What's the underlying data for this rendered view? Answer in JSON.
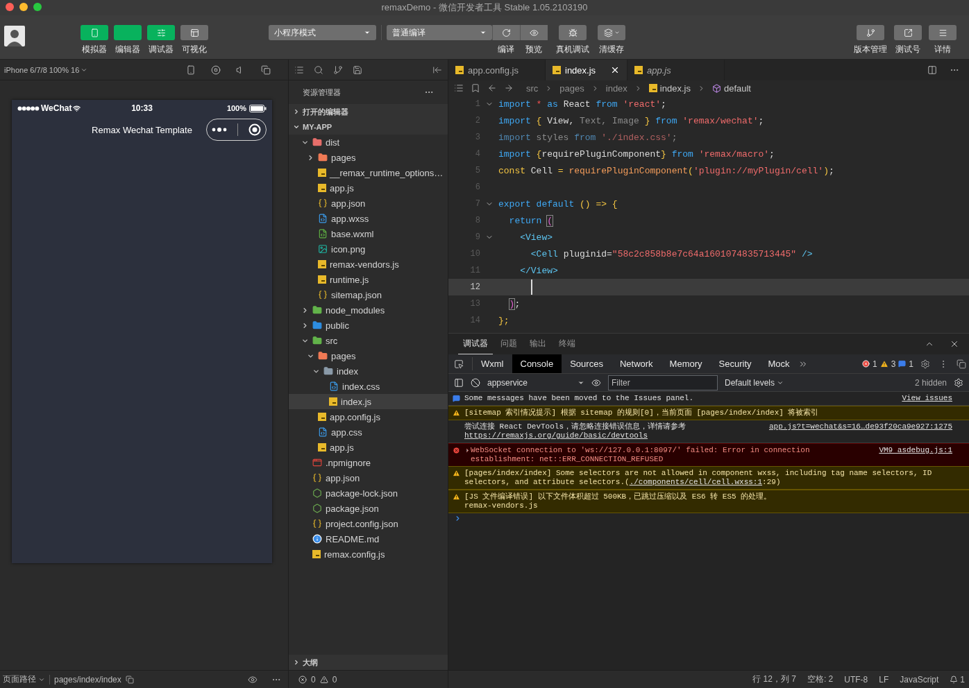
{
  "window": {
    "title": "remaxDemo - 微信开发者工具 Stable 1.05.2103190"
  },
  "toolbar": {
    "views": [
      {
        "label": "模拟器",
        "on": true
      },
      {
        "label": "编辑器",
        "on": true
      },
      {
        "label": "调试器",
        "on": true
      },
      {
        "label": "可视化",
        "on": false
      }
    ],
    "mode_select": "小程序模式",
    "compile_select": "普通编译",
    "actions": [
      {
        "label": "编译"
      },
      {
        "label": "预览"
      }
    ],
    "tools": [
      {
        "label": "真机调试",
        "dropdown": false
      },
      {
        "label": "清缓存",
        "dropdown": true
      }
    ],
    "right": [
      {
        "label": "版本管理"
      },
      {
        "label": "测试号"
      },
      {
        "label": "详情"
      }
    ]
  },
  "simulator": {
    "device": "iPhone 6/7/8 100% 16",
    "carrier": "WeChat",
    "time": "10:33",
    "battery": "100%",
    "page_title": "Remax Wechat Template"
  },
  "explorer": {
    "title": "资源管理器",
    "sections": [
      {
        "label": "打开的编辑器",
        "expanded": false
      },
      {
        "label": "MY-APP",
        "expanded": true
      }
    ],
    "tree": [
      {
        "name": "dist",
        "kind": "folder-red",
        "expanded": true,
        "selected": false,
        "children": [
          {
            "name": "pages",
            "kind": "folder-orange",
            "expanded": false,
            "selected": false
          },
          {
            "name": "__remax_runtime_options…",
            "kind": "js",
            "selected": false
          },
          {
            "name": "app.js",
            "kind": "js",
            "selected": false
          },
          {
            "name": "app.json",
            "kind": "json",
            "selected": false
          },
          {
            "name": "app.wxss",
            "kind": "css",
            "selected": false
          },
          {
            "name": "base.wxml",
            "kind": "wxml",
            "selected": false
          },
          {
            "name": "icon.png",
            "kind": "image",
            "selected": false
          },
          {
            "name": "remax-vendors.js",
            "kind": "js",
            "selected": false
          },
          {
            "name": "runtime.js",
            "kind": "js",
            "selected": false
          },
          {
            "name": "sitemap.json",
            "kind": "json",
            "selected": false
          }
        ]
      },
      {
        "name": "node_modules",
        "kind": "folder-green",
        "expanded": false,
        "selected": false
      },
      {
        "name": "public",
        "kind": "folder-blue",
        "expanded": false,
        "selected": false
      },
      {
        "name": "src",
        "kind": "folder-green",
        "expanded": true,
        "selected": false,
        "children": [
          {
            "name": "pages",
            "kind": "folder-orange",
            "expanded": true,
            "selected": false,
            "children": [
              {
                "name": "index",
                "kind": "folder-grey",
                "expanded": true,
                "selected": false,
                "children": [
                  {
                    "name": "index.css",
                    "kind": "css",
                    "selected": false
                  },
                  {
                    "name": "index.js",
                    "kind": "js",
                    "selected": true
                  }
                ]
              }
            ]
          },
          {
            "name": "app.config.js",
            "kind": "js",
            "selected": false
          },
          {
            "name": "app.css",
            "kind": "css",
            "selected": false
          },
          {
            "name": "app.js",
            "kind": "js",
            "selected": false
          }
        ]
      },
      {
        "name": ".npmignore",
        "kind": "ignore",
        "selected": false
      },
      {
        "name": "app.json",
        "kind": "json",
        "selected": false
      },
      {
        "name": "package-lock.json",
        "kind": "node",
        "selected": false
      },
      {
        "name": "package.json",
        "kind": "node",
        "selected": false
      },
      {
        "name": "project.config.json",
        "kind": "json",
        "selected": false
      },
      {
        "name": "README.md",
        "kind": "info",
        "selected": false
      },
      {
        "name": "remax.config.js",
        "kind": "js",
        "selected": false
      }
    ],
    "outline": {
      "label": "大纲",
      "expanded": false
    }
  },
  "editor": {
    "tabs": [
      {
        "name": "app.config.js",
        "selected": false,
        "preview": false
      },
      {
        "name": "index.js",
        "selected": true,
        "preview": false
      },
      {
        "name": "app.js",
        "selected": false,
        "preview": true
      }
    ],
    "breadcrumb": [
      {
        "label": "src",
        "kind": "folder"
      },
      {
        "label": "pages",
        "kind": "folder"
      },
      {
        "label": "index",
        "kind": "folder"
      },
      {
        "label": "index.js",
        "kind": "file"
      },
      {
        "label": "default",
        "kind": "symbol"
      }
    ],
    "lines": [
      {
        "number": "1",
        "fold": true,
        "current": false,
        "tokens": [
          {
            "text": "import ",
            "kind": "kw"
          },
          {
            "text": "* ",
            "kind": "op"
          },
          {
            "text": "as ",
            "kind": "kw"
          },
          {
            "text": "React ",
            "kind": "id"
          },
          {
            "text": "from ",
            "kind": "kw"
          },
          {
            "text": "'react'",
            "kind": "str"
          },
          {
            "text": ";",
            "kind": "id"
          }
        ]
      },
      {
        "number": "2",
        "fold": false,
        "current": false,
        "tokens": [
          {
            "text": "import ",
            "kind": "kw"
          },
          {
            "text": "{ ",
            "kind": "decl"
          },
          {
            "text": "View, ",
            "kind": "id"
          },
          {
            "text": "Text, Image ",
            "kind": "dim"
          },
          {
            "text": "} ",
            "kind": "decl"
          },
          {
            "text": "from ",
            "kind": "kw"
          },
          {
            "text": "'remax/wechat'",
            "kind": "str"
          },
          {
            "text": ";",
            "kind": "id"
          }
        ]
      },
      {
        "number": "3",
        "fold": false,
        "current": false,
        "tokens": [
          {
            "text": "import ",
            "kind": "dimkw"
          },
          {
            "text": "styles ",
            "kind": "dim"
          },
          {
            "text": "from ",
            "kind": "dimkw"
          },
          {
            "text": "'./index.css'",
            "kind": "dimstr"
          },
          {
            "text": ";",
            "kind": "dim"
          }
        ]
      },
      {
        "number": "4",
        "fold": false,
        "current": false,
        "tokens": [
          {
            "text": "import ",
            "kind": "kw"
          },
          {
            "text": "{",
            "kind": "decl"
          },
          {
            "text": "requirePluginComponent",
            "kind": "id"
          },
          {
            "text": "} ",
            "kind": "decl"
          },
          {
            "text": "from ",
            "kind": "kw"
          },
          {
            "text": "'remax/macro'",
            "kind": "str"
          },
          {
            "text": ";",
            "kind": "id"
          }
        ]
      },
      {
        "number": "5",
        "fold": false,
        "current": false,
        "tokens": [
          {
            "text": "const ",
            "kind": "decl"
          },
          {
            "text": "Cell ",
            "kind": "id"
          },
          {
            "text": "= ",
            "kind": "decl"
          },
          {
            "text": "requirePluginComponent",
            "kind": "fn"
          },
          {
            "text": "(",
            "kind": "decl"
          },
          {
            "text": "'plugin://myPlugin/cell'",
            "kind": "str"
          },
          {
            "text": ")",
            "kind": "decl"
          },
          {
            "text": ";",
            "kind": "id"
          }
        ]
      },
      {
        "number": "6",
        "fold": false,
        "current": false
      },
      {
        "number": "7",
        "fold": true,
        "current": false,
        "tokens": [
          {
            "text": "export default ",
            "kind": "kw"
          },
          {
            "text": "() => {",
            "kind": "decl"
          }
        ]
      },
      {
        "number": "8",
        "fold": false,
        "current": false,
        "tokens": [
          {
            "text": "  return ",
            "kind": "kw"
          },
          {
            "text": "(",
            "kind": "match"
          }
        ]
      },
      {
        "number": "9",
        "fold": true,
        "current": false,
        "tokens": [
          {
            "text": "    <View>",
            "kind": "tag"
          }
        ]
      },
      {
        "number": "10",
        "fold": false,
        "current": false,
        "tokens": [
          {
            "text": "      <Cell ",
            "kind": "tag"
          },
          {
            "text": "pluginid=",
            "kind": "id"
          },
          {
            "text": "\"58c2c858b8e7c64a1601074835713445\"",
            "kind": "str"
          },
          {
            "text": " />",
            "kind": "tag"
          }
        ]
      },
      {
        "number": "11",
        "fold": false,
        "current": false,
        "tokens": [
          {
            "text": "    </View>",
            "kind": "tag"
          }
        ]
      },
      {
        "number": "12",
        "fold": false,
        "current": true
      },
      {
        "number": "13",
        "fold": false,
        "current": false,
        "tokens": [
          {
            "text": "  )",
            "kind": "match"
          },
          {
            "text": ";",
            "kind": "id"
          }
        ]
      },
      {
        "number": "14",
        "fold": false,
        "current": false,
        "tokens": [
          {
            "text": "};",
            "kind": "decl"
          }
        ]
      }
    ]
  },
  "devtools": {
    "panels": [
      {
        "label": "调试器",
        "selected": true
      },
      {
        "label": "问题",
        "selected": false
      },
      {
        "label": "输出",
        "selected": false
      },
      {
        "label": "终端",
        "selected": false
      }
    ],
    "tools": [
      {
        "label": "Wxml",
        "selected": false
      },
      {
        "label": "Console",
        "selected": true
      },
      {
        "label": "Sources",
        "selected": false
      },
      {
        "label": "Network",
        "selected": false
      },
      {
        "label": "Memory",
        "selected": false
      },
      {
        "label": "Security",
        "selected": false
      },
      {
        "label": "Mock",
        "selected": false
      }
    ],
    "counts": {
      "errors": "1",
      "warnings": "3",
      "info": "1"
    },
    "context": "appservice",
    "filter_placeholder": "Filter",
    "levels": "Default levels",
    "hidden": "2 hidden",
    "messages": [
      {
        "kind": "info",
        "text": "Some messages have been moved to the Issues panel.",
        "source": "View issues"
      },
      {
        "kind": "warning",
        "text": "[sitemap 索引情况提示] 根据 sitemap 的规则[0]，当前页面 [pages/index/index] 将被索引"
      },
      {
        "kind": "log",
        "text": "尝试连接 React DevTools，请忽略连接错误信息，详情请参考 ",
        "link": "https://remaxjs.org/guide/basic/devtools",
        "source": "app.js?t=wechat&s=16…de93f20ca9e927:1275"
      },
      {
        "kind": "error",
        "expanded": false,
        "text": "WebSocket connection to 'ws://127.0.0.1:8097/' failed: Error in connection establishment: net::ERR_CONNECTION_REFUSED",
        "source": "VM9 asdebug.js:1"
      },
      {
        "kind": "warning",
        "text": "[pages/index/index] Some selectors are not allowed in component wxss, including tag name selectors, ID selectors, and attribute selectors.(",
        "link": "./components/cell/cell.wxss:1",
        "tail": ":29)"
      },
      {
        "kind": "warning",
        "text": "[JS 文件编译错误] 以下文件体积超过 500KB，已跳过压缩以及 ES6 转 ES5 的处理。",
        "detail": "remax-vendors.js"
      }
    ]
  },
  "status": {
    "page_path_label": "页面路径",
    "page_path": "pages/index/index",
    "errors": "0",
    "warnings": "0",
    "position": "行 12，列 7",
    "indent": "空格: 2",
    "encoding": "UTF-8",
    "eol": "LF",
    "language": "JavaScript",
    "notifications": "1"
  }
}
